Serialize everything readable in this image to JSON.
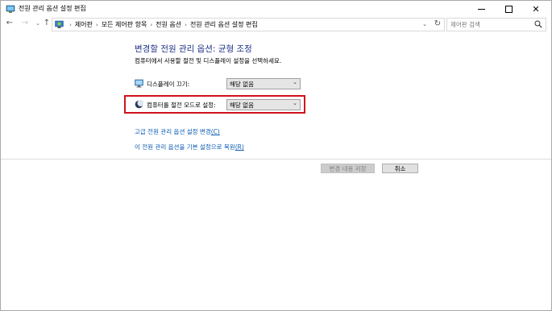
{
  "window": {
    "title": "전원 관리 옵션 설정 편집",
    "app_icon": "power-options-icon",
    "controls": {
      "minimize": "—",
      "maximize": "□",
      "close": "✕"
    }
  },
  "nav": {
    "back_icon": "arrow-left-icon",
    "forward_icon": "arrow-right-icon",
    "recent_icon": "chevron-down-icon",
    "up_icon": "arrow-up-icon",
    "breadcrumbs": [
      "제어판",
      "모든 제어판 항목",
      "전원 옵션",
      "전원 관리 옵션 설정 편집"
    ],
    "search_placeholder": "제어판 검색"
  },
  "main": {
    "heading": "변경할 전원 관리 옵션: 균형 조정",
    "subheading": "컴퓨터에서 사용할 절전 및 디스플레이 설정을 선택하세요.",
    "settings": [
      {
        "label": "디스플레이 끄기:",
        "value": "해당 없음",
        "icon": "monitor-icon"
      },
      {
        "label": "컴퓨터를 절전 모드로 설정:",
        "value": "해당 없음",
        "icon": "moon-icon"
      }
    ],
    "links": [
      {
        "text": "고급 전원 관리 옵션 설정 변경",
        "accel": "(C)"
      },
      {
        "text": "이 전원 관리 옵션을 기본 설정으로 복원",
        "accel": "(R)"
      }
    ],
    "buttons": {
      "save": "변경 내용 저장",
      "cancel": "취소"
    }
  },
  "colors": {
    "heading": "#1e3287",
    "link": "#0a5ab4",
    "highlight_border": "#d0121b"
  }
}
